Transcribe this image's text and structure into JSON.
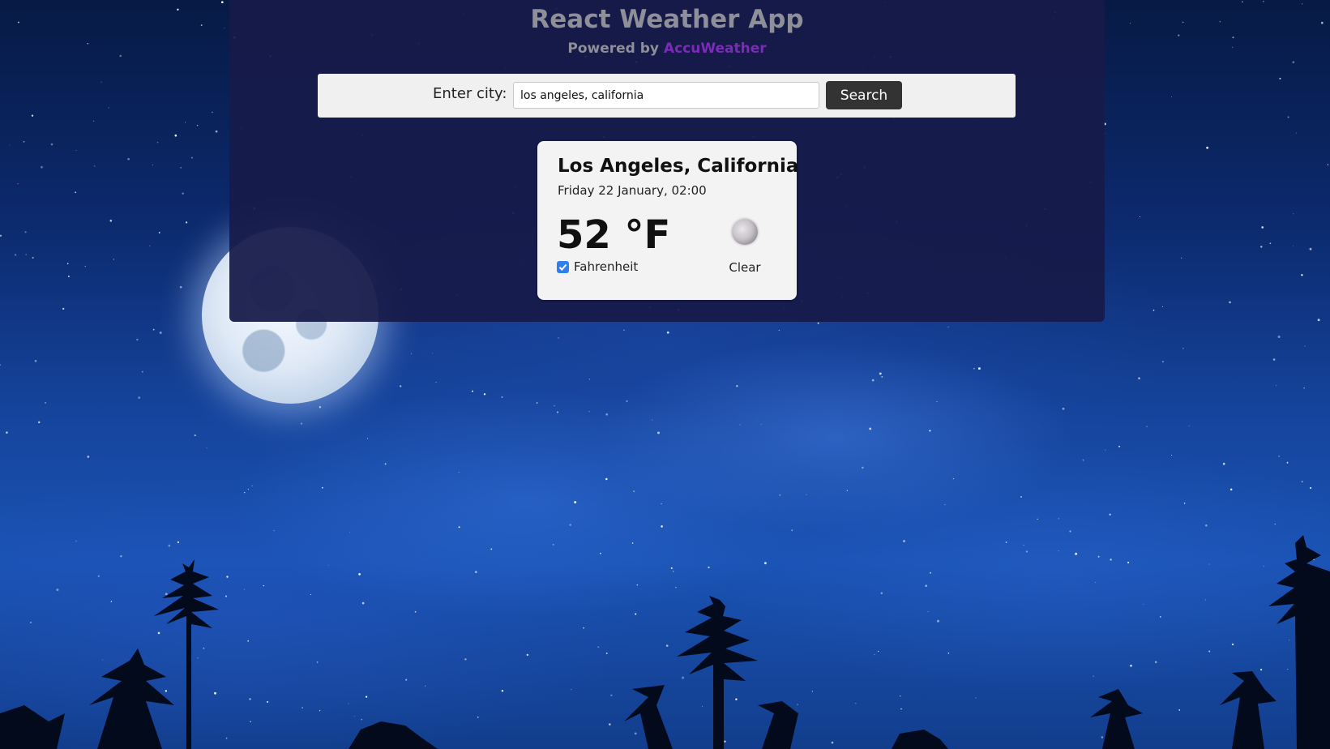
{
  "app": {
    "title": "React Weather App",
    "powered_prefix": "Powered by",
    "powered_brand": "AccuWeather"
  },
  "search": {
    "label": "Enter city:",
    "value": "los angeles, california",
    "button_label": "Search"
  },
  "weather": {
    "city": "Los Angeles, California",
    "datetime": "Friday 22 January, 02:00",
    "temperature": "52 °F",
    "unit_toggle_label": "Fahrenheit",
    "unit_toggle_checked": true,
    "condition": "Clear",
    "condition_icon": "moon-icon"
  },
  "colors": {
    "header_panel": "#161b49",
    "brand_accent": "#7b2bb8",
    "button_bg": "#333333",
    "checkbox": "#2f7ff0"
  }
}
